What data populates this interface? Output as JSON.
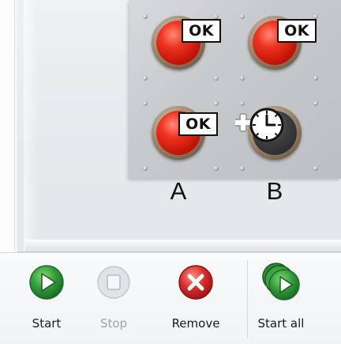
{
  "panel": {
    "lamps": [
      {
        "state": "red",
        "badge": "OK"
      },
      {
        "state": "red",
        "badge": "OK"
      },
      {
        "state": "red",
        "badge": "OK"
      },
      {
        "state": "off",
        "badge": ""
      }
    ],
    "labels": [
      "A",
      "B"
    ]
  },
  "toolbar": {
    "start_label": "Start",
    "stop_label": "Stop",
    "remove_label": "Remove",
    "start_all_label": "Start all"
  },
  "colors": {
    "lamp_red": "#e02a18",
    "start_green": "#2f9a3a",
    "remove_red": "#d62a2a",
    "disabled_gray": "#9ea3a8"
  },
  "icons": {
    "start": "play-icon",
    "stop": "stop-icon",
    "remove": "close-icon",
    "start_all": "play-all-icon",
    "add_timer": "add-timer-icon"
  }
}
